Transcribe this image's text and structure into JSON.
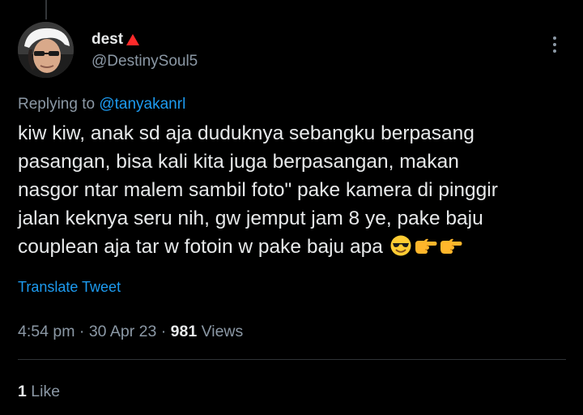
{
  "author": {
    "display_name": "dest",
    "badge_color": "#ff2a2a",
    "handle": "@DestinySoul5",
    "avatar_icon": "profile-photo-icon"
  },
  "reply": {
    "prefix": "Replying to ",
    "mention": "@tanyakanrl"
  },
  "tweet": {
    "lines": [
      "kiw kiw, anak sd aja duduknya sebangku berpasang",
      "pasangan, bisa kali kita juga berpasangan, makan",
      "nasgor ntar malem sambil foto\" pake kamera di pinggir",
      "jalan keknya seru nih, gw jemput jam 8 ye, pake baju",
      "couplean aja tar w fotoin w pake baju apa "
    ],
    "emojis": [
      "smiling-face-with-sunglasses-icon",
      "pointing-right-icon",
      "pointing-right-icon"
    ]
  },
  "actions": {
    "translate_label": "Translate Tweet",
    "more_icon": "more-options-icon"
  },
  "meta": {
    "time": "4:54 pm",
    "separator": " · ",
    "date": "30 Apr 23",
    "views_count": "981",
    "views_label": " Views"
  },
  "engagement": {
    "like_count": "1",
    "like_label": " Like"
  },
  "colors": {
    "background": "#000000",
    "text": "#e7e9ea",
    "muted": "#8b98a5",
    "link": "#1d9bf0",
    "divider": "#2f3336"
  }
}
